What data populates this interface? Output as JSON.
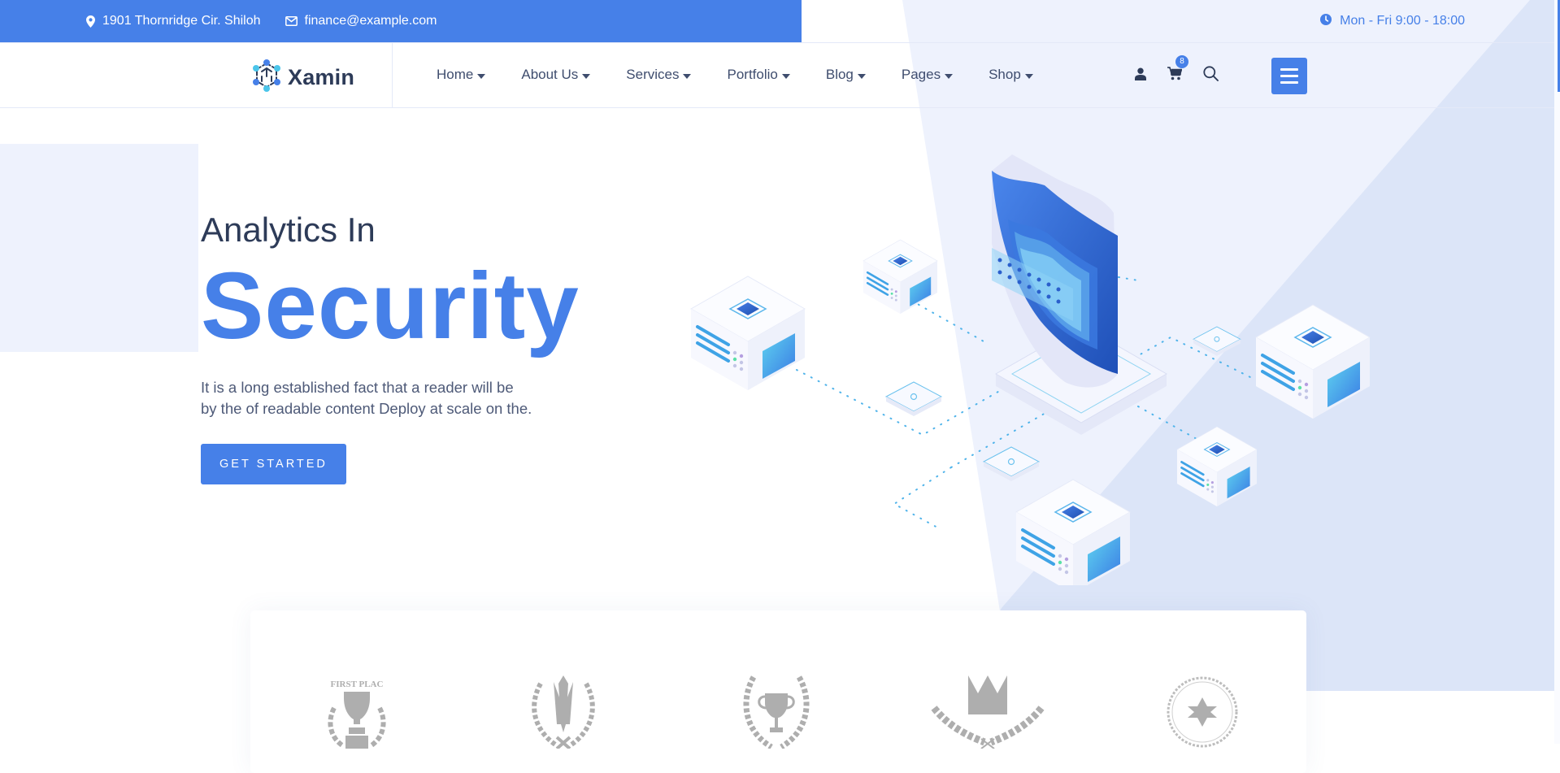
{
  "topbar": {
    "address_icon": "map-marker-icon",
    "address": "1901 Thornridge Cir. Shiloh",
    "email_icon": "envelope-icon",
    "email": "finance@example.com",
    "hours_icon": "clock-icon",
    "hours": "Mon - Fri 9:00 - 18:00"
  },
  "brand": {
    "logo_icon": "hexagon-network-logo-icon",
    "name": "Xamin"
  },
  "nav": {
    "items": [
      {
        "label": "Home"
      },
      {
        "label": "About Us"
      },
      {
        "label": "Services"
      },
      {
        "label": "Portfolio"
      },
      {
        "label": "Blog"
      },
      {
        "label": "Pages"
      },
      {
        "label": "Shop"
      }
    ],
    "icons": {
      "user": "user-icon",
      "cart": "cart-icon",
      "cart_count": "8",
      "search": "search-icon",
      "menu": "hamburger-menu-icon"
    }
  },
  "hero": {
    "subtitle": "Analytics In",
    "title": "Security",
    "description_line1": "It is a long established fact that a reader will be",
    "description_line2": "by the of readable content Deploy at scale on the.",
    "cta_label": "GET STARTED",
    "illustration": "isometric-security-shield-servers-illustration"
  },
  "awards": {
    "items": [
      {
        "name": "first-place-trophy-award",
        "text": "FIRST PLAC"
      },
      {
        "name": "star-laurel-award",
        "text": ""
      },
      {
        "name": "trophy-laurel-award",
        "text": ""
      },
      {
        "name": "crown-laurel-award",
        "text": ""
      },
      {
        "name": "star-chain-seal-award",
        "text": ""
      }
    ]
  },
  "colors": {
    "primary": "#4680e8",
    "heading": "#2d3b58",
    "body_text": "#4e5a78",
    "bg_light": "#eef2fd",
    "bg_blue": "#dce5f8",
    "award_gray": "#aeaeae"
  }
}
